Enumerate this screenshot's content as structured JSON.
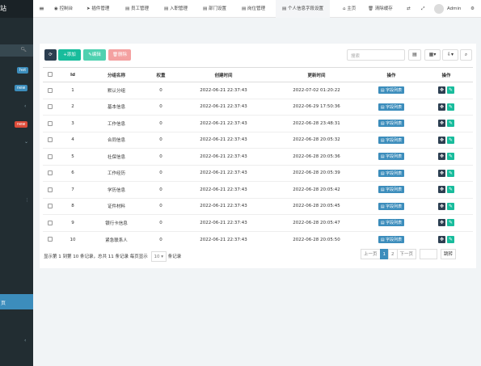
{
  "sidebar": {
    "logo": "站",
    "badges": {
      "hot": "hot",
      "new1": "new",
      "new2": "new"
    },
    "active_item": "页"
  },
  "topbar": {
    "menu_label": "≡",
    "tabs": [
      {
        "label": "控制台",
        "icon": "dashboard-icon"
      },
      {
        "label": "插件管理",
        "icon": "rocket-icon"
      },
      {
        "label": "员工管理",
        "icon": "list-icon"
      },
      {
        "label": "入职管理",
        "icon": "list-icon"
      },
      {
        "label": "部门设置",
        "icon": "list-icon"
      },
      {
        "label": "岗位管理",
        "icon": "list-icon"
      },
      {
        "label": "个人信息字段设置",
        "icon": "list-icon"
      }
    ],
    "home_label": "主页",
    "clear_cache_label": "清除缓存",
    "user_name": "Admin"
  },
  "toolbar": {
    "add_label": "添加",
    "edit_label": "编辑",
    "delete_label": "删除",
    "search_placeholder": "搜索"
  },
  "table": {
    "headers": {
      "id": "Id",
      "name": "分组名称",
      "weight": "权重",
      "created": "创建时间",
      "updated": "更新时间",
      "op1": "操作",
      "op2": "操作"
    },
    "tag_label": "字段列表",
    "rows": [
      {
        "id": "1",
        "name": "默认分组",
        "weight": "0",
        "created": "2022-06-21 22:37:43",
        "updated": "2022-07-02 01:20:22"
      },
      {
        "id": "2",
        "name": "基本信息",
        "weight": "0",
        "created": "2022-06-21 22:37:43",
        "updated": "2022-06-29 17:50:36"
      },
      {
        "id": "3",
        "name": "工作信息",
        "weight": "0",
        "created": "2022-06-21 22:37:43",
        "updated": "2022-06-28 23:48:31"
      },
      {
        "id": "4",
        "name": "合同信息",
        "weight": "0",
        "created": "2022-06-21 22:37:43",
        "updated": "2022-06-28 20:05:32"
      },
      {
        "id": "5",
        "name": "社保信息",
        "weight": "0",
        "created": "2022-06-21 22:37:43",
        "updated": "2022-06-28 20:05:36"
      },
      {
        "id": "6",
        "name": "工作经历",
        "weight": "0",
        "created": "2022-06-21 22:37:43",
        "updated": "2022-06-28 20:05:39"
      },
      {
        "id": "7",
        "name": "学历信息",
        "weight": "0",
        "created": "2022-06-21 22:37:43",
        "updated": "2022-06-28 20:05:42"
      },
      {
        "id": "8",
        "name": "证件材料",
        "weight": "0",
        "created": "2022-06-21 22:37:43",
        "updated": "2022-06-28 20:05:45"
      },
      {
        "id": "9",
        "name": "银行卡信息",
        "weight": "0",
        "created": "2022-06-21 22:37:43",
        "updated": "2022-06-28 20:05:47"
      },
      {
        "id": "10",
        "name": "紧急联系人",
        "weight": "0",
        "created": "2022-06-21 22:37:43",
        "updated": "2022-06-28 20:05:50"
      }
    ]
  },
  "footer": {
    "summary": "显示第 1 到第 10 条记录，总共 11 条记录 每页显示",
    "page_size": "10 ▾",
    "suffix": "条记录"
  },
  "pager": {
    "prev": "上一页",
    "pages": [
      "1",
      "2"
    ],
    "next": "下一页",
    "jump": "跳转"
  },
  "colors": {
    "sidebar": "#222d32",
    "primary": "#3c8dbc",
    "add": "#18bc9c",
    "edit": "#4fd1b0",
    "delete": "#f4a1a1",
    "dark": "#2c3e50"
  }
}
